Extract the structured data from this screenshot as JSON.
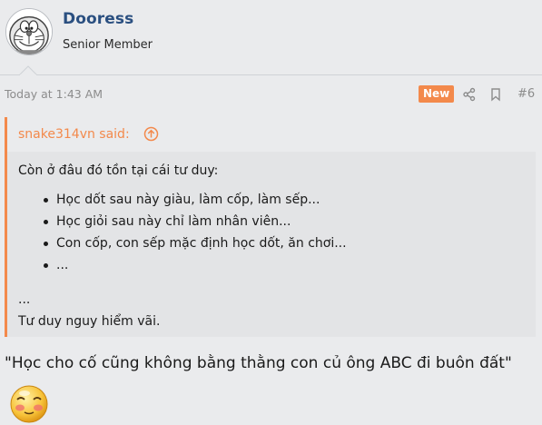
{
  "user": {
    "name": "Dooress",
    "title": "Senior Member",
    "avatar_icon": "doraemon-avatar-icon"
  },
  "post": {
    "time": "Today at 1:43 AM",
    "badge": "New",
    "share_icon": "share-icon",
    "bookmark_icon": "bookmark-icon",
    "number": "#6"
  },
  "quote": {
    "author": "snake314vn said:",
    "jump_icon": "arrow-circle-up-icon",
    "intro": "Còn ở đâu đó tồn tại cái tư duy:",
    "items": [
      "Học dốt sau này giàu, làm cốp, làm sếp...",
      "Học giỏi sau này chỉ làm nhân viên...",
      "Con cốp, con sếp mặc định học dốt, ăn chơi...",
      "..."
    ],
    "ellipsis": "...",
    "outro": "Tư duy nguy hiểm vãi."
  },
  "message": {
    "text": "\"Học cho cố cũng không bằng thằng con củ ông ABC đi buôn đất\"",
    "emoji_icon": "embarrassed-smile-icon"
  },
  "colors": {
    "accent": "#f3894b",
    "username": "#2a4f80",
    "background": "#eaebed",
    "quote_bg": "#e3e4e6"
  }
}
